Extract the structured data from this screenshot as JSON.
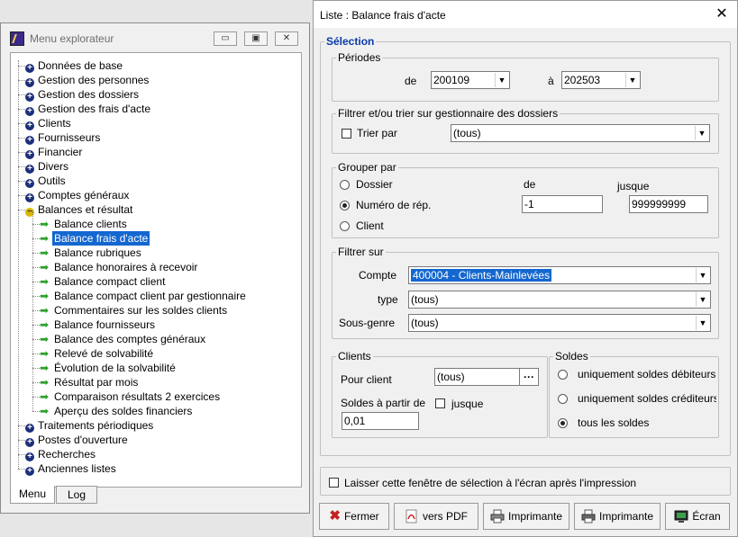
{
  "explorer": {
    "title": "Menu explorateur",
    "window_buttons": [
      "▭",
      "▣",
      "✕"
    ],
    "tree": [
      {
        "label": "Données de base",
        "type": "folder"
      },
      {
        "label": "Gestion des personnes",
        "type": "folder"
      },
      {
        "label": "Gestion des dossiers",
        "type": "folder"
      },
      {
        "label": "Gestion des frais d'acte",
        "type": "folder"
      },
      {
        "label": "Clients",
        "type": "folder"
      },
      {
        "label": "Fournisseurs",
        "type": "folder"
      },
      {
        "label": "Financier",
        "type": "folder"
      },
      {
        "label": "Divers",
        "type": "folder"
      },
      {
        "label": "Outils",
        "type": "folder"
      },
      {
        "label": "Comptes généraux",
        "type": "folder"
      },
      {
        "label": "Balances et résultat",
        "type": "open"
      },
      {
        "label": "Balance clients",
        "type": "child"
      },
      {
        "label": "Balance frais d'acte",
        "type": "child",
        "selected": true
      },
      {
        "label": "Balance rubriques",
        "type": "child"
      },
      {
        "label": "Balance honoraires à recevoir",
        "type": "child"
      },
      {
        "label": "Balance compact client",
        "type": "child"
      },
      {
        "label": "Balance compact client par gestionnaire",
        "type": "child"
      },
      {
        "label": "Commentaires sur les soldes clients",
        "type": "child"
      },
      {
        "label": "Balance fournisseurs",
        "type": "child"
      },
      {
        "label": "Balance des comptes généraux",
        "type": "child"
      },
      {
        "label": "Relevé de solvabilité",
        "type": "child"
      },
      {
        "label": "Évolution de la solvabilité",
        "type": "child"
      },
      {
        "label": "Résultat par mois",
        "type": "child"
      },
      {
        "label": "Comparaison résultats 2 exercices",
        "type": "child"
      },
      {
        "label": "Aperçu des soldes financiers",
        "type": "child"
      },
      {
        "label": "Traitements périodiques",
        "type": "folder"
      },
      {
        "label": "Postes d'ouverture",
        "type": "folder"
      },
      {
        "label": "Recherches",
        "type": "folder"
      },
      {
        "label": "Anciennes listes",
        "type": "folder"
      }
    ],
    "tabs": [
      "Menu",
      "Log"
    ],
    "active_tab": "Menu"
  },
  "dialog": {
    "title": "Liste : Balance frais d'acte",
    "close": "✕",
    "selection_legend": "Sélection",
    "periodes": {
      "legend": "Périodes",
      "de_label": "de",
      "de_value": "200109",
      "a_label": "à",
      "a_value": "202503"
    },
    "filtre_gest": {
      "legend": "Filtrer et/ou trier sur gestionnaire des dossiers",
      "trier_label": "Trier par",
      "trier_checked": false,
      "value": "(tous)"
    },
    "grouper": {
      "legend": "Grouper par",
      "options": [
        "Dossier",
        "Numéro de rép.",
        "Client"
      ],
      "selected": "Numéro de rép.",
      "de_label": "de",
      "jusque_label": "jusque",
      "de_value": "-1",
      "jusque_value": "999999999"
    },
    "filtrer": {
      "legend": "Filtrer sur",
      "compte_label": "Compte",
      "compte_value": "400004 - Clients-Mainlevées",
      "type_label": "type",
      "type_value": "(tous)",
      "sousgenre_label": "Sous-genre",
      "sousgenre_value": "(tous)"
    },
    "clients": {
      "legend": "Clients",
      "pour_label": "Pour client",
      "pour_value": "(tous)",
      "browse": "···",
      "soldes_label": "Soldes à partir de",
      "jusque_label": "jusque",
      "jusque_checked": false,
      "soldes_value": "0,01"
    },
    "soldes": {
      "legend": "Soldes",
      "options": [
        "uniquement soldes débiteurs",
        "uniquement soldes créditeurs",
        "tous les soldes"
      ],
      "selected": "tous les soldes"
    },
    "keep_open_label": "Laisser cette fenêtre de sélection à l'écran après l'impression",
    "keep_open_checked": false,
    "buttons": {
      "fermer": "Fermer",
      "pdf": "vers PDF",
      "imprimante1": "Imprimante",
      "imprimante2": "Imprimante",
      "ecran": "Écran"
    },
    "colors": {
      "selection_blue": "#1467cf",
      "legend_blue": "#0a3aa8",
      "fermer_red": "#c62020"
    }
  }
}
